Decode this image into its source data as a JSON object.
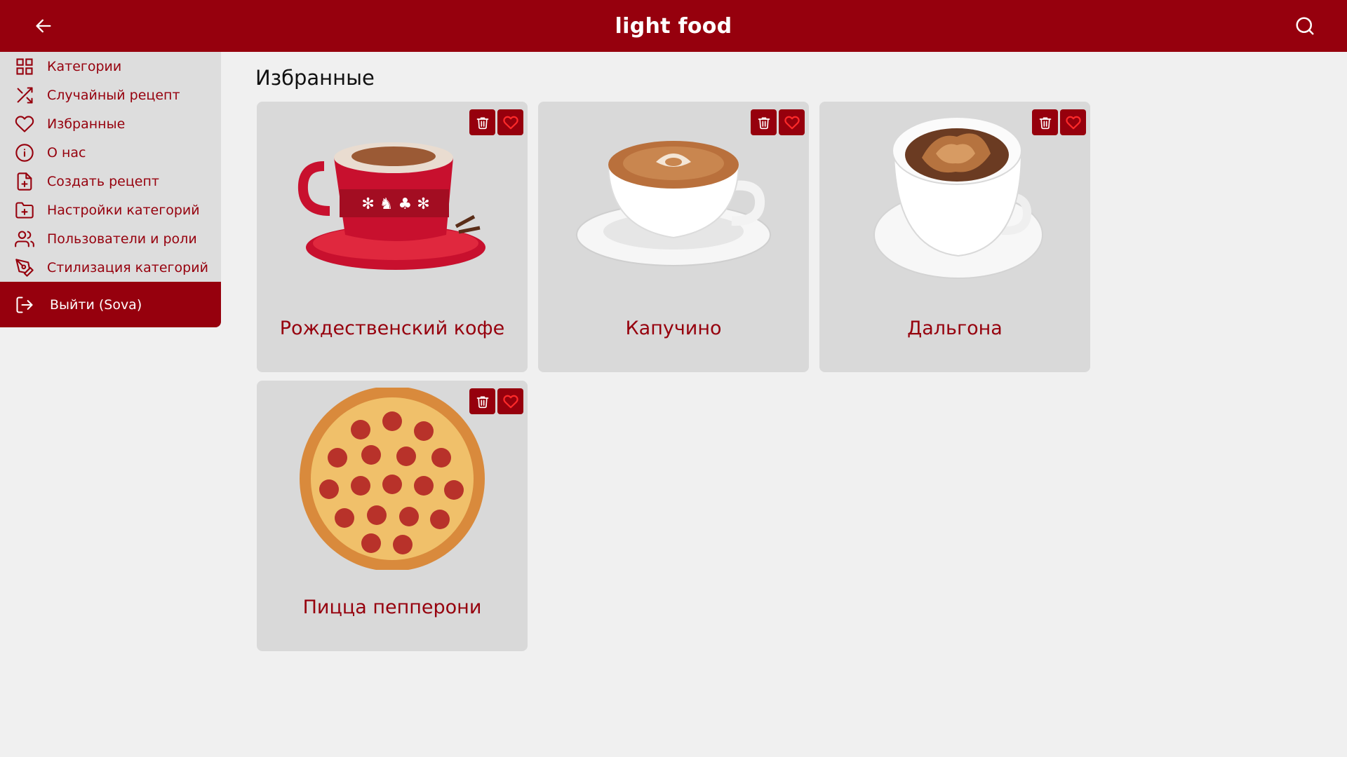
{
  "app": {
    "title": "light food"
  },
  "header": {
    "back_icon": "arrow-left-icon",
    "search_icon": "search-icon"
  },
  "sidebar": {
    "items": [
      {
        "label": "Категории",
        "icon": "grid-icon"
      },
      {
        "label": "Случайный рецепт",
        "icon": "shuffle-icon"
      },
      {
        "label": "Избранные",
        "icon": "heart-icon"
      },
      {
        "label": "О нас",
        "icon": "info-icon"
      },
      {
        "label": "Создать рецепт",
        "icon": "file-plus-icon"
      },
      {
        "label": "Настройки категорий",
        "icon": "folder-plus-icon"
      },
      {
        "label": "Пользователи и роли",
        "icon": "users-icon"
      },
      {
        "label": "Стилизация категорий",
        "icon": "pen-tool-icon"
      }
    ],
    "logout": {
      "label": "Выйти (Sova)",
      "icon": "logout-icon"
    }
  },
  "main": {
    "title": "Избранные",
    "cards": [
      {
        "name": "Рождественский кофе",
        "image": "christmas-coffee-image"
      },
      {
        "name": "Капучино",
        "image": "cappuccino-image"
      },
      {
        "name": "Дальгона",
        "image": "dalgona-image"
      },
      {
        "name": "Пицца пепперони",
        "image": "pepperoni-pizza-image"
      }
    ]
  },
  "colors": {
    "brand": "#96000d",
    "background": "#f0f0f0",
    "sidebar": "#dddddd",
    "card": "#d9d9d9",
    "heart": "#ff2a2a"
  }
}
